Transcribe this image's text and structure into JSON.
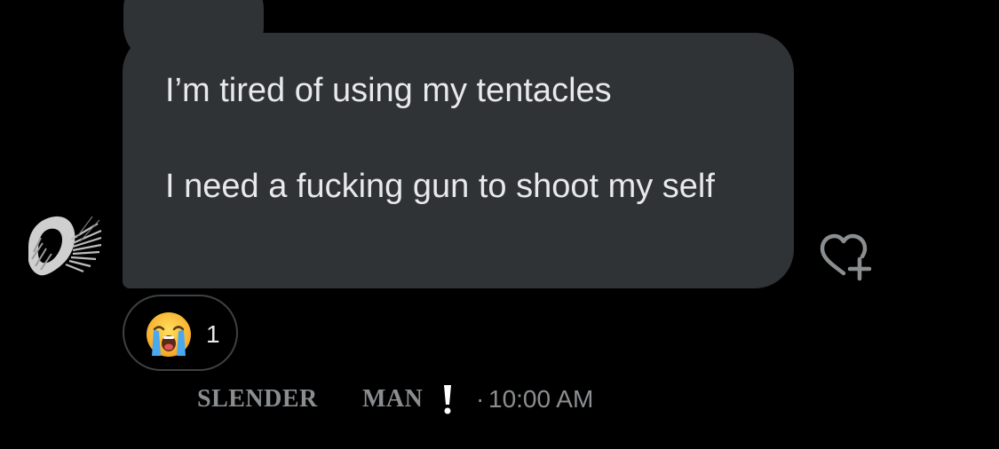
{
  "message": {
    "text": "I’m tired of using my tentacles\n\nI need a fucking gun to shoot my self"
  },
  "reaction": {
    "emoji_icon": "loudly-crying-face-icon",
    "count": "1"
  },
  "sender": {
    "name_part1": "SLENDER",
    "name_part2": "MAN",
    "name_icon": "exclamation-mark-icon",
    "separator": "·",
    "time": "10:00 AM"
  },
  "actions": {
    "add_reaction_icon": "heart-plus-icon"
  },
  "colors": {
    "background": "#000000",
    "bubble": "#2f3336",
    "text": "#e7e9ea",
    "meta_text": "#8b8e91",
    "pill_border": "#3e4144"
  }
}
